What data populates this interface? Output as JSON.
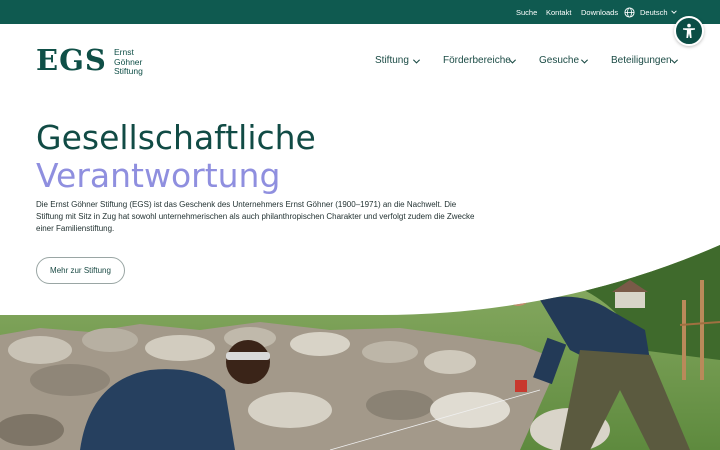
{
  "topbar": {
    "links": [
      "Suche",
      "Kontakt",
      "Downloads"
    ],
    "language": "Deutsch"
  },
  "accessibility": {
    "icon": "accessibility-icon"
  },
  "logo": {
    "mark": "EGS",
    "name_line1": "Ernst",
    "name_line2": "Göhner",
    "name_line3": "Stiftung"
  },
  "nav": {
    "items": [
      {
        "label": "Stiftung"
      },
      {
        "label": "Förderbereiche"
      },
      {
        "label": "Gesuche"
      },
      {
        "label": "Beteiligungen"
      }
    ]
  },
  "hero": {
    "title_line1": "Gesellschaftliche",
    "title_line2": "Verantwortung",
    "intro": "Die Ernst Göhner Stiftung (EGS) ist das Geschenk des Unternehmers Ernst Göhner (1900–1971) an die Nachwelt. Die Stiftung mit Sitz in Zug hat sowohl unternehmerischen als auch philanthropischen Charakter und verfolgt zudem die Zwecke einer Familienstiftung.",
    "cta_label": "Mehr zur Stiftung"
  },
  "colors": {
    "topbar": "#0f5a50",
    "brand": "#0f4f47",
    "accent_lavender": "#8f8fdf"
  }
}
